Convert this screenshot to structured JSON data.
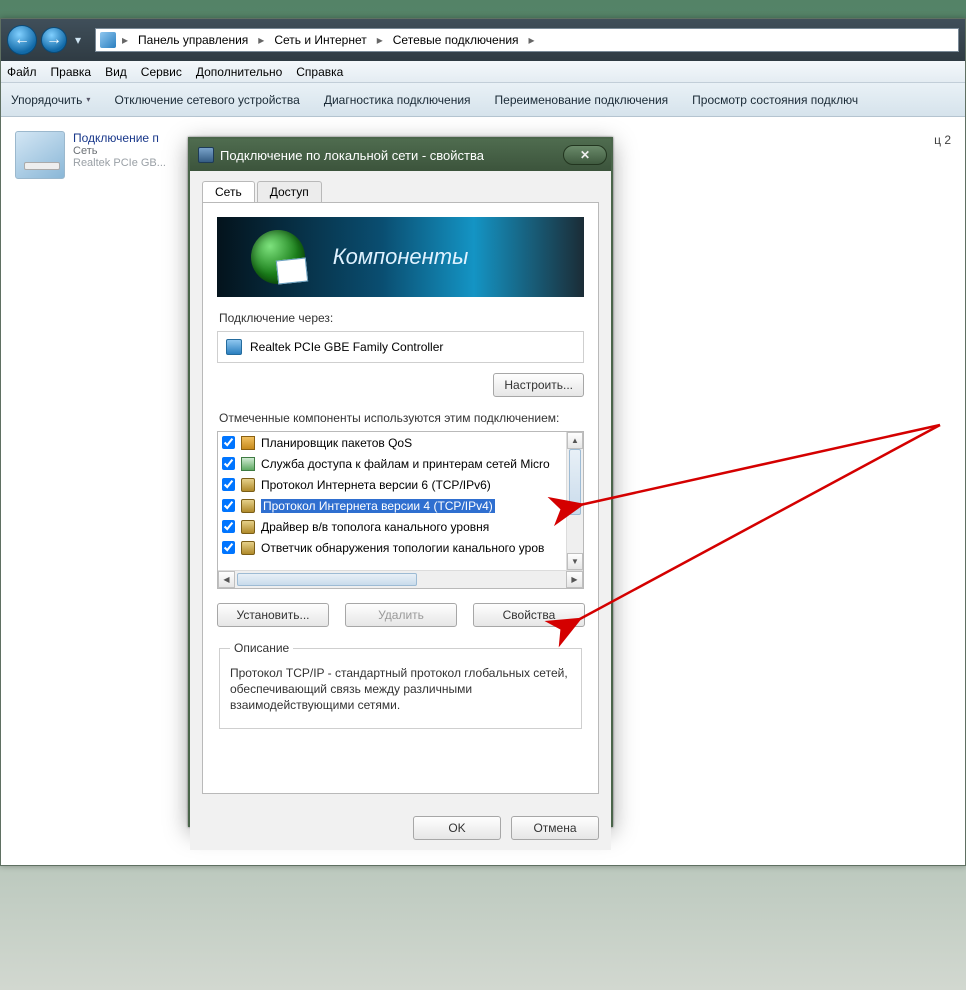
{
  "breadcrumb": {
    "items": [
      "Панель управления",
      "Сеть и Интернет",
      "Сетевые подключения"
    ]
  },
  "menubar": {
    "items": [
      "Файл",
      "Правка",
      "Вид",
      "Сервис",
      "Дополнительно",
      "Справка"
    ]
  },
  "toolbar": {
    "organize": "Упорядочить",
    "disable": "Отключение сетевого устройства",
    "diagnose": "Диагностика подключения",
    "rename": "Переименование подключения",
    "status": "Просмотр состояния подключ"
  },
  "connections": {
    "item1": {
      "name": "Подключение п",
      "status": "Сеть",
      "device": "Realtek PCIe GB..."
    },
    "hint_right": "ц 2"
  },
  "dialog": {
    "title": "Подключение по локальной сети - свойства",
    "tabs": {
      "network": "Сеть",
      "sharing": "Доступ"
    },
    "banner_text": "Компоненты",
    "connect_using_label": "Подключение через:",
    "adapter": "Realtek PCIe GBE Family Controller",
    "configure_btn": "Настроить...",
    "components_label": "Отмеченные компоненты используются этим подключением:",
    "components": [
      {
        "label": "Планировщик пакетов QoS",
        "icon": "sched",
        "checked": true,
        "selected": false
      },
      {
        "label": "Служба доступа к файлам и принтерам сетей Micro",
        "icon": "share",
        "checked": true,
        "selected": false
      },
      {
        "label": "Протокол Интернета версии 6 (TCP/IPv6)",
        "icon": "proto",
        "checked": true,
        "selected": false
      },
      {
        "label": "Протокол Интернета версии 4 (TCP/IPv4)",
        "icon": "proto",
        "checked": true,
        "selected": true
      },
      {
        "label": "Драйвер в/в тополога канального уровня",
        "icon": "proto",
        "checked": true,
        "selected": false
      },
      {
        "label": "Ответчик обнаружения топологии канального уров",
        "icon": "proto",
        "checked": true,
        "selected": false
      }
    ],
    "install_btn": "Установить...",
    "uninstall_btn": "Удалить",
    "properties_btn": "Свойства",
    "description_heading": "Описание",
    "description_text": "Протокол TCP/IP - стандартный протокол глобальных сетей, обеспечивающий связь между различными взаимодействующими сетями.",
    "ok_btn": "OK",
    "cancel_btn": "Отмена"
  }
}
